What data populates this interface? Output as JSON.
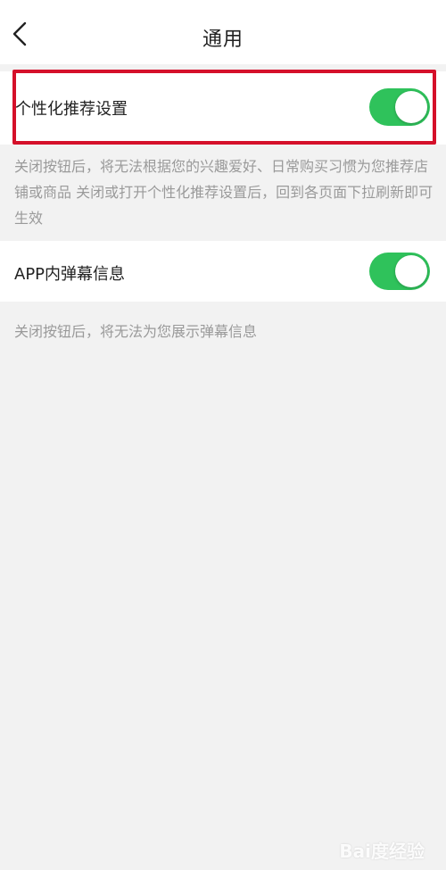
{
  "navbar": {
    "title": "通用",
    "back_icon": "chevron-left-icon"
  },
  "settings": {
    "personalized": {
      "label": "个性化推荐设置",
      "enabled": true,
      "description": "关闭按钮后，将无法根据您的兴趣爱好、日常购买习惯为您推荐店铺或商品  关闭或打开个性化推荐设置后，回到各页面下拉刷新即可生效"
    },
    "danmaku": {
      "label": "APP内弹幕信息",
      "enabled": true,
      "description": "关闭按钮后，将无法为您展示弹幕信息"
    }
  },
  "watermark": {
    "text": "Bai度经验"
  },
  "colors": {
    "toggle_on": "#2fc25b",
    "highlight": "#d5102a",
    "background": "#f2f2f2",
    "desc_text": "#9a9a9a"
  }
}
